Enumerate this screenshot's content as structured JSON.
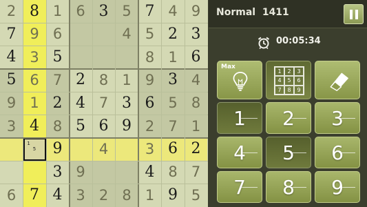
{
  "header": {
    "difficulty": "Normal",
    "puzzle_number": "1411",
    "timer": "00:05:34"
  },
  "icons": {
    "pause": "pause-icon",
    "alarm": "alarm-clock-icon",
    "hint": "lightbulb-icon",
    "notes": "notes-grid-icon",
    "eraser": "eraser-icon"
  },
  "tools": {
    "hint_badge": "Max",
    "note_digits": [
      "1",
      "2",
      "3",
      "4",
      "5",
      "6",
      "7",
      "8",
      "9"
    ]
  },
  "keypad": [
    "1",
    "2",
    "3",
    "4",
    "5",
    "6",
    "7",
    "8",
    "9"
  ],
  "keypad_active": [
    "1",
    "5"
  ],
  "board": {
    "rows": [
      [
        "2",
        "8",
        "1",
        "6",
        "3",
        "5",
        "7",
        "4",
        "9"
      ],
      [
        "7",
        "9",
        "6",
        "",
        "",
        "4",
        "5",
        "2",
        "3"
      ],
      [
        "4",
        "3",
        "5",
        "",
        "",
        "",
        "8",
        "1",
        "6"
      ],
      [
        "5",
        "6",
        "7",
        "2",
        "8",
        "1",
        "9",
        "3",
        "4"
      ],
      [
        "9",
        "1",
        "2",
        "4",
        "7",
        "3",
        "6",
        "5",
        "8"
      ],
      [
        "3",
        "4",
        "8",
        "5",
        "6",
        "9",
        "2",
        "7",
        "1"
      ],
      [
        "",
        "",
        "9",
        "",
        "4",
        "",
        "3",
        "6",
        "2"
      ],
      [
        "",
        "",
        "3",
        "9",
        "",
        "",
        "4",
        "8",
        "7"
      ],
      [
        "6",
        "7",
        "4",
        "3",
        "2",
        "8",
        "1",
        "9",
        "5"
      ]
    ],
    "entry_type": [
      [
        "u",
        "g",
        "u",
        "u",
        "g",
        "u",
        "g",
        "u",
        "u"
      ],
      [
        "g",
        "u",
        "u",
        "",
        "",
        "u",
        "u",
        "g",
        "g"
      ],
      [
        "g",
        "u",
        "g",
        "",
        "",
        "",
        "u",
        "u",
        "g"
      ],
      [
        "g",
        "u",
        "u",
        "g",
        "u",
        "u",
        "u",
        "g",
        "u"
      ],
      [
        "u",
        "u",
        "g",
        "g",
        "u",
        "g",
        "g",
        "u",
        "u"
      ],
      [
        "u",
        "g",
        "u",
        "g",
        "g",
        "g",
        "u",
        "u",
        "u"
      ],
      [
        "",
        "",
        "g",
        "",
        "u",
        "",
        "u",
        "g",
        "g"
      ],
      [
        "",
        "",
        "g",
        "u",
        "",
        "",
        "g",
        "u",
        "u"
      ],
      [
        "u",
        "g",
        "g",
        "u",
        "u",
        "u",
        "u",
        "g",
        "u"
      ]
    ],
    "selected_cell_notes": [
      "1",
      "",
      "",
      "",
      "5",
      "",
      "",
      "",
      ""
    ],
    "colors": {
      "base": "#d4d9b4",
      "alt_box": "#c3c8a3",
      "row_highlight": "#ece87b",
      "col_highlight": "#f0ee5a",
      "selected": "#d8d6a4"
    }
  }
}
